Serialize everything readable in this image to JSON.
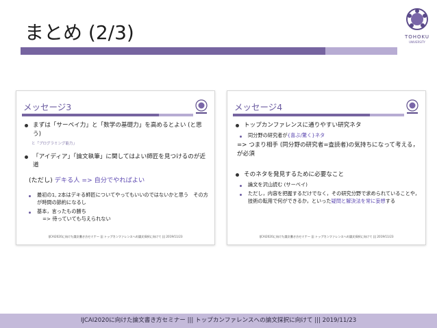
{
  "title": "まとめ (2/3)",
  "logo": {
    "text": "TOHOKU",
    "sub": "UNIVERSITY"
  },
  "slide_left": {
    "title": "メッセージ3",
    "b1": "まずは「サーベイ力」と「数学の基礎力」を高めるとよい (と思う)",
    "b1_note": "と「プログラミング能力」",
    "b2": "「アイディア」「論文執筆」に関してはよい師匠を見つけるのが近道",
    "paren_prefix": "(ただし) ",
    "paren_accent": "デキる人 => 自分でやればよい",
    "s1": "最初の1, 2本はデキる師匠についてやってもいいのではないかと思う　その方が時間の節約になるし",
    "s2": "基本，言ったもの勝ち",
    "s2b": "=> 待っていても与えられない",
    "footer": "IJCAI2020に向けた論文書き方セミナー ||| トップカンファレンスへの論文採択に向けて ||| 2019/11/23"
  },
  "slide_right": {
    "title": "メッセージ4",
    "b1": "トップカンファレンスに通りやすい研究ネタ",
    "s1_prefix": "同分野の研究者が",
    "s1_accent": "{喜ぶ/驚く}ネタ",
    "arrow": "=> つまり相手 (同分野の研究者=査読者)の気持ちになって考える，が必須",
    "b2": "そのネタを発見するために必要なこと",
    "s2": "論文を沢山読む (サーベイ)",
    "s3_prefix": "ただし，内容を把握するだけでなく，その研究分野で求められていることや，技術の転用で何ができるか，といった",
    "s3_accent": "疑問と解決法を常に妄想",
    "s3_suffix": "する",
    "footer": "IJCAI2020に向けた論文書き方セミナー ||| トップカンファレンスへの論文採択に向けて ||| 2019/11/23"
  },
  "footer": "IJCAI2020に向けた論文書き方セミナー ||| トップカンファレンスへの論文採択に向けて ||| 2019/11/23",
  "colors": {
    "accent": "#6a5aa0",
    "bar": "#7664a0",
    "bar_light": "#b7acd3",
    "footer_bg": "#c4bada"
  }
}
